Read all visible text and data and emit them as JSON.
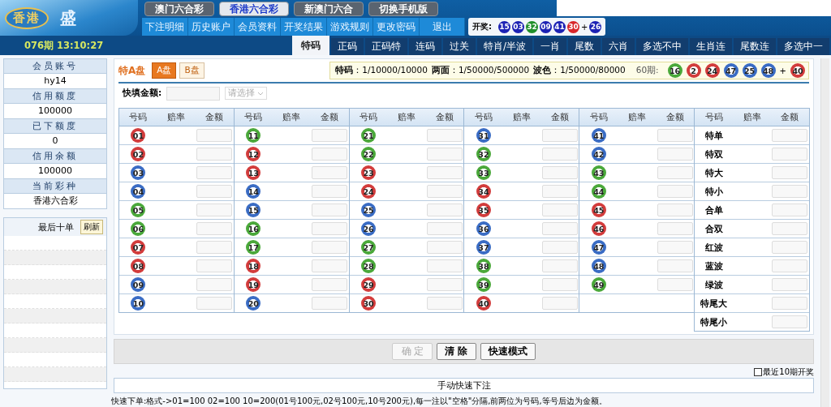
{
  "logo": {
    "region": "香港",
    "brand": "盛"
  },
  "lottery_tabs": [
    {
      "label": "澳门六合彩",
      "selected": false
    },
    {
      "label": "香港六合彩",
      "selected": true
    },
    {
      "label": "新澳门六合",
      "selected": false
    },
    {
      "label": "切换手机版",
      "selected": false
    }
  ],
  "nav_links": [
    "下注明细",
    "历史账户",
    "会员资料",
    "开奖结果",
    "游戏规则",
    "更改密码",
    "退出"
  ],
  "draw": {
    "label": "开奖:",
    "balls": [
      {
        "number": "15",
        "color": "#1c22b4"
      },
      {
        "number": "03",
        "color": "#1c22b4"
      },
      {
        "number": "32",
        "color": "#1f8f2a"
      },
      {
        "number": "09",
        "color": "#1c22b4"
      },
      {
        "number": "41",
        "color": "#1c22b4"
      },
      {
        "number": "30",
        "color": "#d8262a"
      }
    ],
    "plus": "+",
    "bonus": {
      "number": "26",
      "color": "#1c22b4"
    }
  },
  "period_time": "076期 13:10:27",
  "play_tabs": [
    {
      "label": "特码",
      "selected": true
    },
    {
      "label": "正码",
      "selected": false
    },
    {
      "label": "正码特",
      "selected": false
    },
    {
      "label": "连码",
      "selected": false
    },
    {
      "label": "过关",
      "selected": false
    },
    {
      "label": "特肖/半波",
      "selected": false
    },
    {
      "label": "一肖",
      "selected": false
    },
    {
      "label": "尾数",
      "selected": false
    },
    {
      "label": "六肖",
      "selected": false
    },
    {
      "label": "多选不中",
      "selected": false
    },
    {
      "label": "生肖连",
      "selected": false
    },
    {
      "label": "尾数连",
      "selected": false
    },
    {
      "label": "多选中一",
      "selected": false
    }
  ],
  "account": [
    {
      "label": "会员账号",
      "value": "hy14"
    },
    {
      "label": "信用额度",
      "value": "100000"
    },
    {
      "label": "已下额度",
      "value": "0"
    },
    {
      "label": "信用余额",
      "value": "100000"
    },
    {
      "label": "当前彩种",
      "value": "香港六合彩"
    }
  ],
  "recent_orders": {
    "title": "最后十单",
    "refresh": "刷新"
  },
  "market": {
    "title": "特A盘",
    "options": [
      {
        "label": "A盘",
        "selected": true
      },
      {
        "label": "B盘",
        "selected": false
      }
    ]
  },
  "limits": [
    {
      "label": "特码",
      "value": "：1/10000/10000"
    },
    {
      "label": "两面",
      "value": "：1/50000/500000"
    },
    {
      "label": "波色",
      "value": "：1/50000/80000"
    }
  ],
  "last_draw": {
    "label": "60期:",
    "balls": [
      {
        "number": "16",
        "color": "#4aa83a"
      },
      {
        "number": "2",
        "color": "#d23c3c"
      },
      {
        "number": "24",
        "color": "#d23c3c"
      },
      {
        "number": "47",
        "color": "#3a6cc4"
      },
      {
        "number": "25",
        "color": "#3a6cc4"
      },
      {
        "number": "48",
        "color": "#3a6cc4"
      }
    ],
    "plus": "+",
    "bonus": {
      "number": "40",
      "color": "#d23c3c"
    }
  },
  "quick_fill": {
    "label": "快填金额:",
    "select_text": "请选择"
  },
  "groups": [
    {
      "kind": "ball",
      "headers": [
        "号码",
        "赔率",
        "金额"
      ],
      "rows": [
        {
          "number": "01",
          "color": "#d23c3c"
        },
        {
          "number": "02",
          "color": "#d23c3c"
        },
        {
          "number": "03",
          "color": "#3a6cc4"
        },
        {
          "number": "04",
          "color": "#3a6cc4"
        },
        {
          "number": "05",
          "color": "#4aa83a"
        },
        {
          "number": "06",
          "color": "#4aa83a"
        },
        {
          "number": "07",
          "color": "#d23c3c"
        },
        {
          "number": "08",
          "color": "#d23c3c"
        },
        {
          "number": "09",
          "color": "#3a6cc4"
        },
        {
          "number": "10",
          "color": "#3a6cc4"
        }
      ]
    },
    {
      "kind": "ball",
      "headers": [
        "号码",
        "赔率",
        "金额"
      ],
      "rows": [
        {
          "number": "11",
          "color": "#4aa83a"
        },
        {
          "number": "12",
          "color": "#d23c3c"
        },
        {
          "number": "13",
          "color": "#d23c3c"
        },
        {
          "number": "14",
          "color": "#3a6cc4"
        },
        {
          "number": "15",
          "color": "#3a6cc4"
        },
        {
          "number": "16",
          "color": "#4aa83a"
        },
        {
          "number": "17",
          "color": "#4aa83a"
        },
        {
          "number": "18",
          "color": "#d23c3c"
        },
        {
          "number": "19",
          "color": "#d23c3c"
        },
        {
          "number": "20",
          "color": "#3a6cc4"
        }
      ]
    },
    {
      "kind": "ball",
      "headers": [
        "号码",
        "赔率",
        "金额"
      ],
      "rows": [
        {
          "number": "21",
          "color": "#4aa83a"
        },
        {
          "number": "22",
          "color": "#4aa83a"
        },
        {
          "number": "23",
          "color": "#d23c3c"
        },
        {
          "number": "24",
          "color": "#d23c3c"
        },
        {
          "number": "25",
          "color": "#3a6cc4"
        },
        {
          "number": "26",
          "color": "#3a6cc4"
        },
        {
          "number": "27",
          "color": "#4aa83a"
        },
        {
          "number": "28",
          "color": "#4aa83a"
        },
        {
          "number": "29",
          "color": "#d23c3c"
        },
        {
          "number": "30",
          "color": "#d23c3c"
        }
      ]
    },
    {
      "kind": "ball",
      "headers": [
        "号码",
        "赔率",
        "金额"
      ],
      "rows": [
        {
          "number": "31",
          "color": "#3a6cc4"
        },
        {
          "number": "32",
          "color": "#4aa83a"
        },
        {
          "number": "33",
          "color": "#4aa83a"
        },
        {
          "number": "34",
          "color": "#d23c3c"
        },
        {
          "number": "35",
          "color": "#d23c3c"
        },
        {
          "number": "36",
          "color": "#3a6cc4"
        },
        {
          "number": "37",
          "color": "#3a6cc4"
        },
        {
          "number": "38",
          "color": "#4aa83a"
        },
        {
          "number": "39",
          "color": "#4aa83a"
        },
        {
          "number": "40",
          "color": "#d23c3c"
        }
      ]
    },
    {
      "kind": "ball",
      "headers": [
        "号码",
        "赔率",
        "金额"
      ],
      "rows": [
        {
          "number": "41",
          "color": "#3a6cc4"
        },
        {
          "number": "42",
          "color": "#3a6cc4"
        },
        {
          "number": "43",
          "color": "#4aa83a"
        },
        {
          "number": "44",
          "color": "#4aa83a"
        },
        {
          "number": "45",
          "color": "#d23c3c"
        },
        {
          "number": "46",
          "color": "#d23c3c"
        },
        {
          "number": "47",
          "color": "#3a6cc4"
        },
        {
          "number": "48",
          "color": "#3a6cc4"
        },
        {
          "number": "49",
          "color": "#4aa83a"
        }
      ]
    },
    {
      "kind": "text",
      "headers": [
        "号码",
        "赔率",
        "金额"
      ],
      "rows": [
        {
          "label": "特单"
        },
        {
          "label": "特双"
        },
        {
          "label": "特大"
        },
        {
          "label": "特小"
        },
        {
          "label": "合单"
        },
        {
          "label": "合双"
        },
        {
          "label": "红波"
        },
        {
          "label": "蓝波"
        },
        {
          "label": "绿波"
        },
        {
          "label": "特尾大"
        },
        {
          "label": "特尾小"
        }
      ]
    }
  ],
  "buttons": [
    {
      "label": "确 定",
      "disabled": true
    },
    {
      "label": "清 除",
      "disabled": false
    },
    {
      "label": "快速模式",
      "disabled": false
    }
  ],
  "recent10": {
    "label": "最近10期开奖",
    "checked": false
  },
  "manual": {
    "title": "手动快速下注",
    "hint": "快速下单:格式->01=100 02=100 10=200(01号100元,02号100元,10号200元),每一注以\"空格\"分隔,前两位为号码,等号后边为金额。"
  }
}
